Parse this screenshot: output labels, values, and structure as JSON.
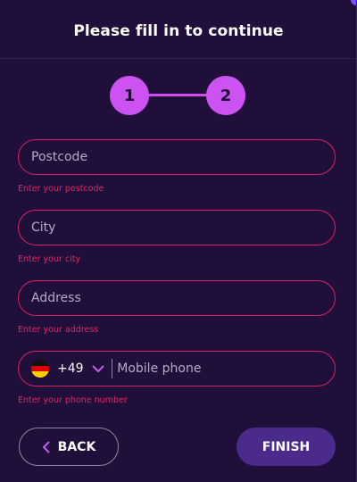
{
  "header": {
    "title": "Please fill in to continue"
  },
  "stepper": {
    "steps": [
      "1",
      "2"
    ],
    "active_step": 2
  },
  "form": {
    "postcode": {
      "placeholder": "Postcode",
      "value": "",
      "error": "Enter your postcode"
    },
    "city": {
      "placeholder": "City",
      "value": "",
      "error": "Enter your city"
    },
    "address": {
      "placeholder": "Address",
      "value": "",
      "error": "Enter your address"
    },
    "phone": {
      "country_flag": "germany-flag-icon",
      "dial_code": "+49",
      "placeholder": "Mobile phone",
      "value": "",
      "error": "Enter your phone number"
    }
  },
  "actions": {
    "back_label": "BACK",
    "finish_label": "FINISH"
  },
  "colors": {
    "background": "#1f0f3a",
    "step_accent": "#cd52f2",
    "error": "#e2265f",
    "finish_button": "#4a2a8b",
    "chevron": "#c45cf0"
  }
}
